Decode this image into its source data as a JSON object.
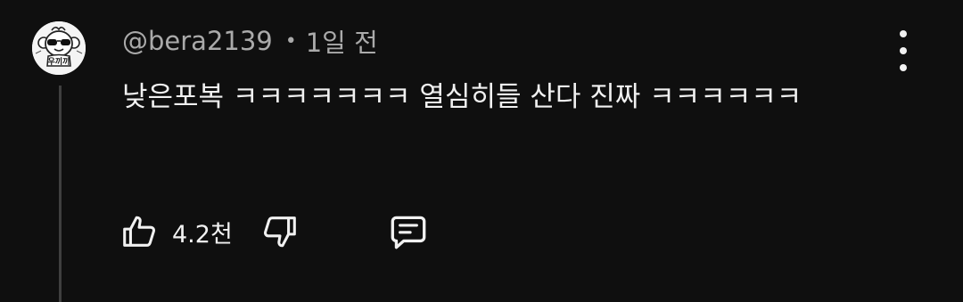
{
  "comment": {
    "author": "@bera2139",
    "separator": "•",
    "time_ago": "1일 전",
    "text": "낮은포복 ㅋㅋㅋㅋㅋㅋㅋ 열심히들 산다 진짜 ㅋㅋㅋㅋㅋㅋ",
    "like_count": "4.2천",
    "avatar_text": "우끼끼"
  },
  "icons": {
    "like": "thumbs-up-icon",
    "dislike": "thumbs-down-icon",
    "reply": "comment-icon",
    "menu": "more-vert-icon"
  },
  "colors": {
    "background": "#0f0f0f",
    "primary_text": "#f1f1f1",
    "secondary_text": "#aaaaaa",
    "thread_line": "#3f3f3f"
  }
}
